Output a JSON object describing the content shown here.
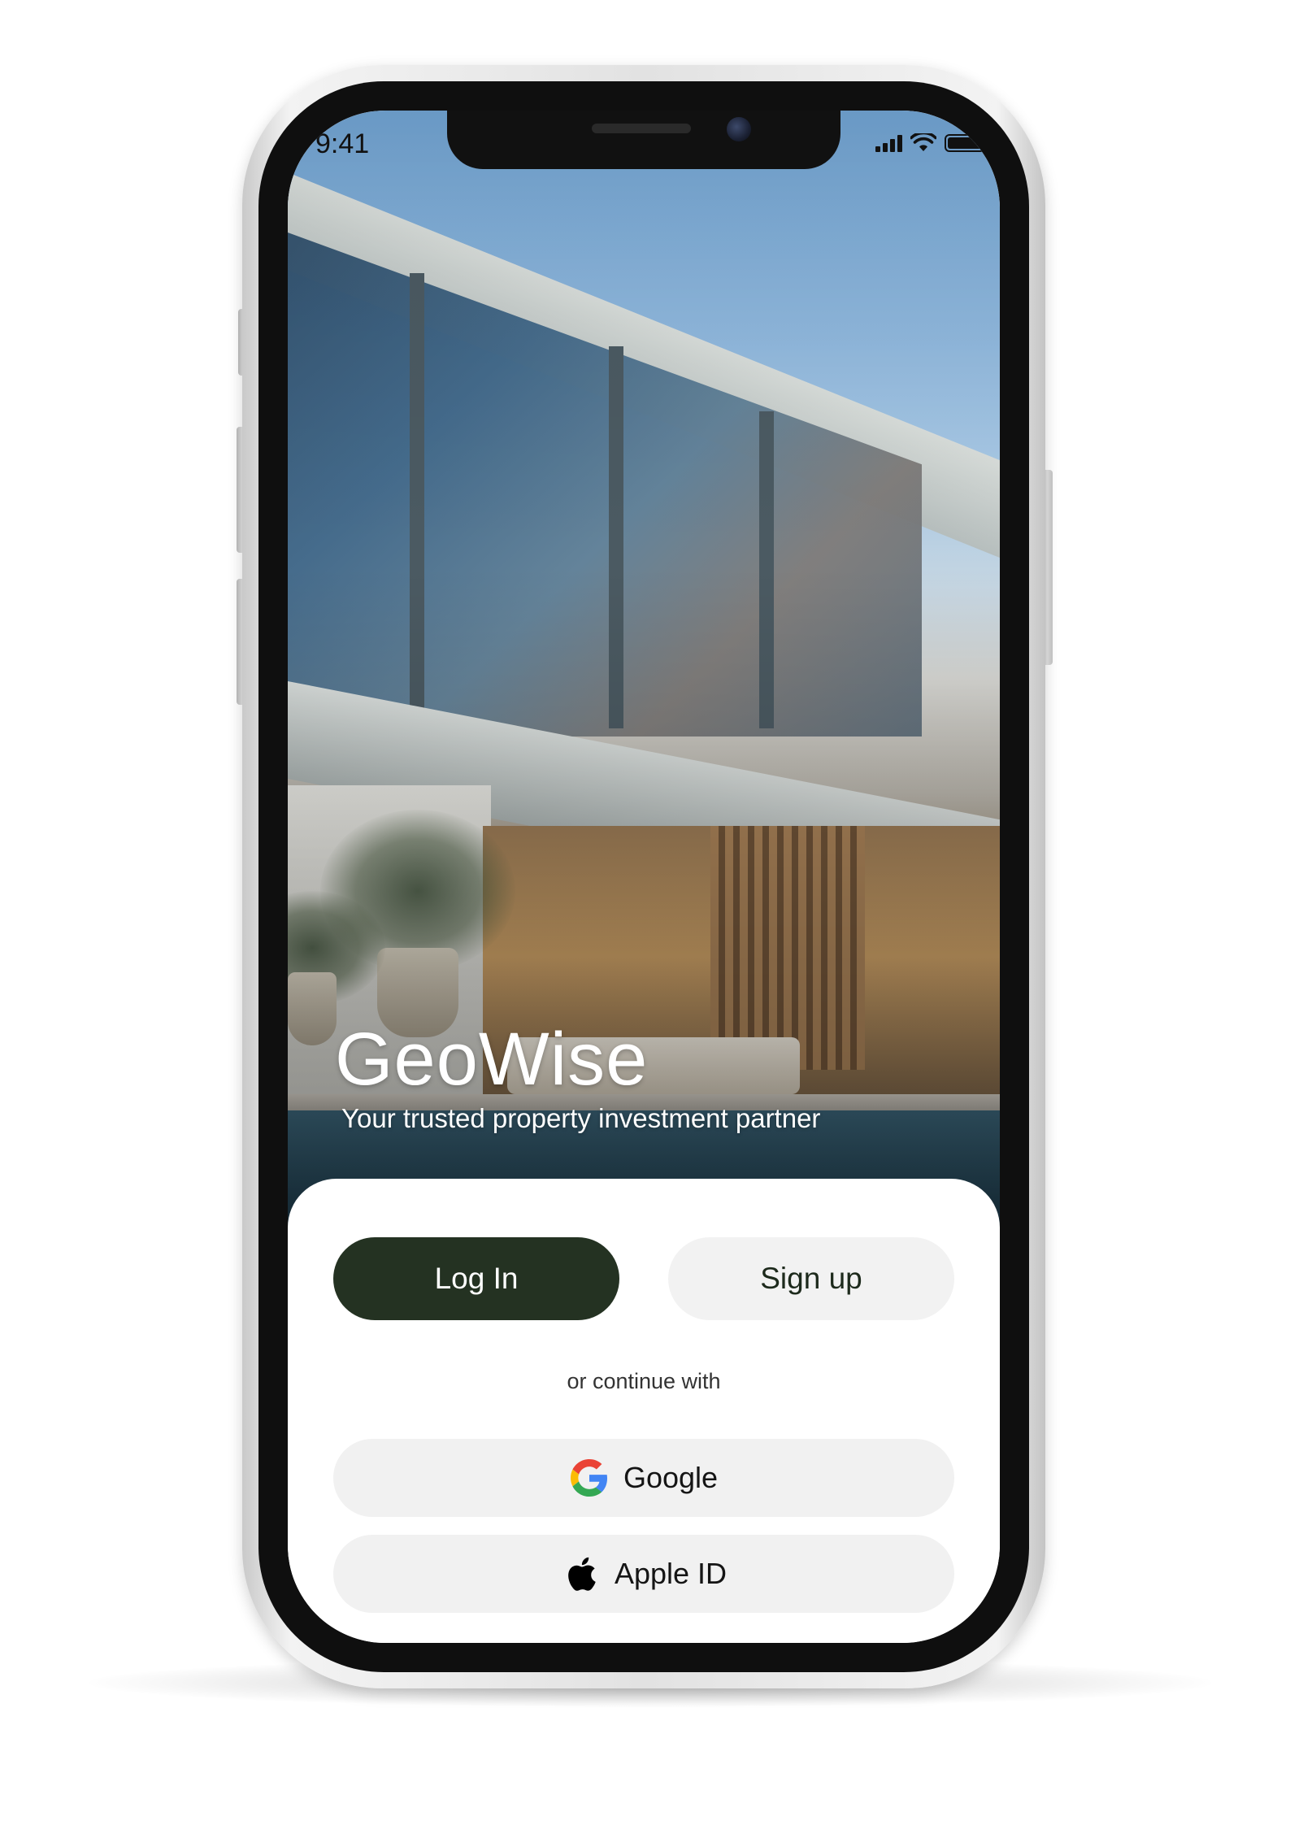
{
  "status_bar": {
    "time": "9:41"
  },
  "hero": {
    "title": "GeoWise",
    "subtitle": "Your trusted property investment partner"
  },
  "auth": {
    "login_label": "Log In",
    "signup_label": "Sign up",
    "divider_text": "or continue with",
    "google_label": "Google",
    "apple_label": "Apple ID"
  },
  "icons": {
    "status": [
      "signal-icon",
      "wifi-icon",
      "battery-icon"
    ],
    "google": "google-icon",
    "apple": "apple-icon"
  },
  "colors": {
    "primary_button": "#243222",
    "secondary_button": "#f2f2f2",
    "sheet_background": "#ffffff",
    "title_text": "#ffffff"
  }
}
